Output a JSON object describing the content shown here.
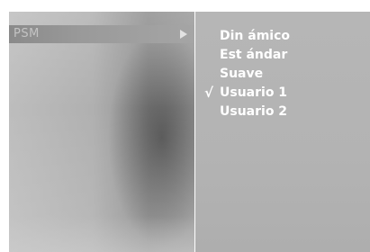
{
  "menu": {
    "main_item_label": "PSM",
    "submenu_arrow_icon": "triangle-right-icon",
    "check_icon": "check-mark-icon",
    "check_symbol": "√",
    "options": [
      {
        "label": "Din ámico",
        "selected": false
      },
      {
        "label": "Est ándar",
        "selected": false
      },
      {
        "label": "Suave",
        "selected": false
      },
      {
        "label": "Usuario 1",
        "selected": true
      },
      {
        "label": "Usuario 2",
        "selected": false
      }
    ]
  }
}
